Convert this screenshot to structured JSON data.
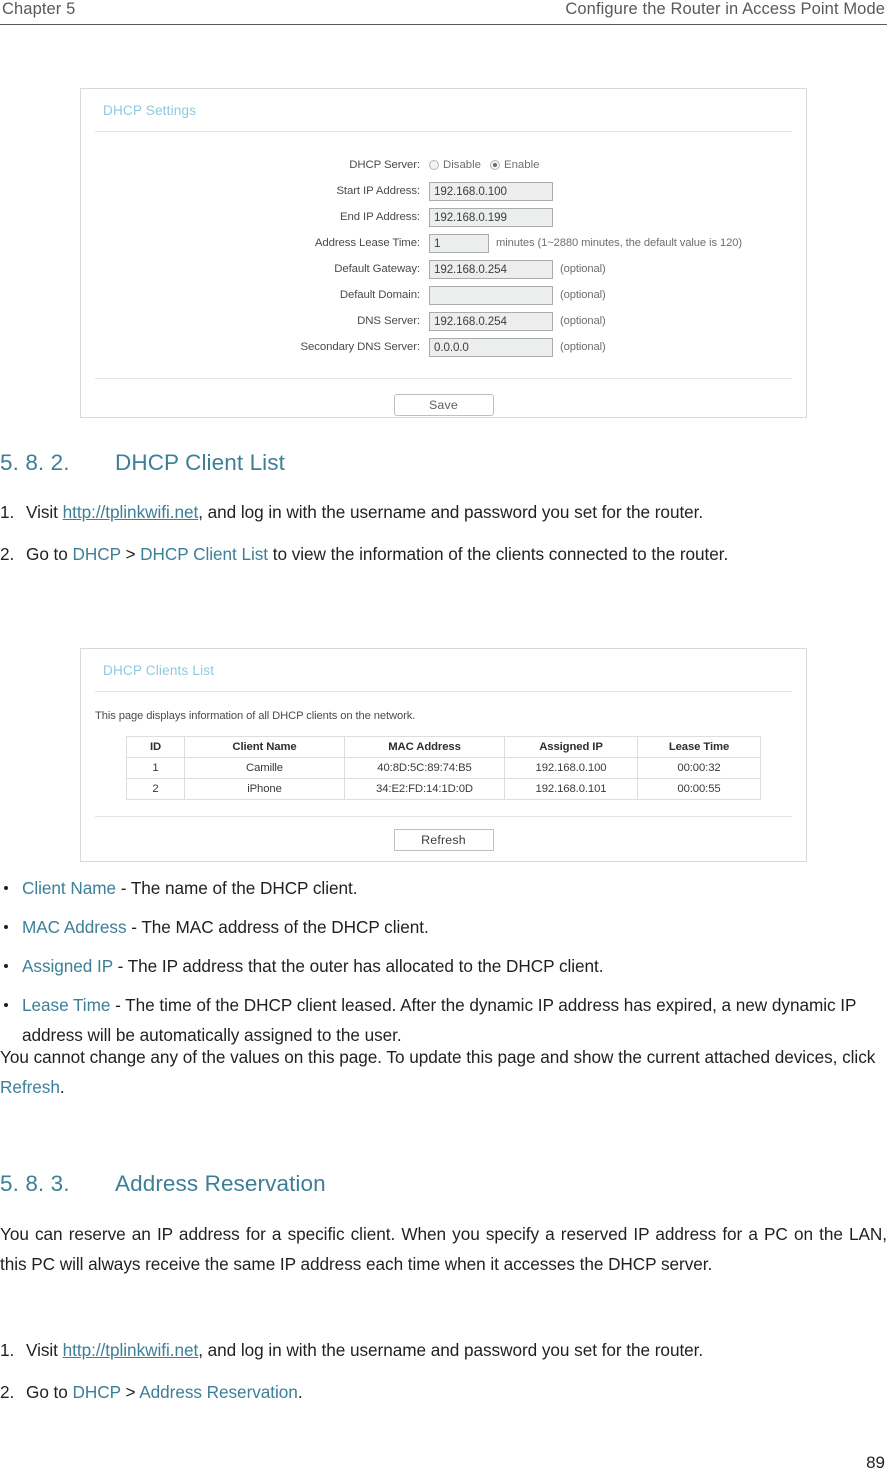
{
  "header": {
    "chapter": "Chapter 5",
    "title": "Configure the Router in Access Point Mode"
  },
  "dhcp_settings_panel": {
    "title": "DHCP Settings",
    "rows": {
      "dhcp_server_label": "DHCP Server:",
      "dhcp_server_disable": "Disable",
      "dhcp_server_enable": "Enable",
      "dhcp_server_selected": "Enable",
      "start_ip_label": "Start IP Address:",
      "start_ip_value": "192.168.0.100",
      "end_ip_label": "End IP Address:",
      "end_ip_value": "192.168.0.199",
      "lease_time_label": "Address Lease Time:",
      "lease_time_value": "1",
      "lease_time_hint": "minutes (1~2880 minutes, the default value is 120)",
      "gateway_label": "Default Gateway:",
      "gateway_value": "192.168.0.254",
      "gateway_hint": "(optional)",
      "domain_label": "Default Domain:",
      "domain_value": "",
      "domain_hint": "(optional)",
      "dns_label": "DNS Server:",
      "dns_value": "192.168.0.254",
      "dns_hint": "(optional)",
      "secondary_dns_label": "Secondary DNS Server:",
      "secondary_dns_value": "0.0.0.0",
      "secondary_dns_hint": "(optional)"
    },
    "save_label": "Save"
  },
  "section_582": {
    "number": "5. 8. 2.",
    "title": "DHCP Client List",
    "steps": [
      {
        "marker": "1.",
        "pre": "Visit ",
        "link": "http://tplinkwifi.net",
        "post": ", and log in with the username and password you set for the router."
      },
      {
        "marker": "2.",
        "pre": "Go to ",
        "nav1": "DHCP",
        "sep": " > ",
        "nav2": "DHCP Client List",
        "post": " to view the information of the clients connected to the router."
      }
    ]
  },
  "clients_panel": {
    "title": "DHCP Clients List",
    "note": "This page displays information of all DHCP clients on the network.",
    "columns": [
      "ID",
      "Client Name",
      "MAC Address",
      "Assigned IP",
      "Lease Time"
    ],
    "rows": [
      [
        "1",
        "Camille",
        "40:8D:5C:89:74:B5",
        "192.168.0.100",
        "00:00:32"
      ],
      [
        "2",
        "iPhone",
        "34:E2:FD:14:1D:0D",
        "192.168.0.101",
        "00:00:55"
      ]
    ],
    "refresh_label": "Refresh"
  },
  "field_bullets": [
    {
      "term": "Client Name",
      "desc": " - The name of the DHCP client."
    },
    {
      "term": "MAC Address",
      "desc": " - The MAC address of the DHCP client."
    },
    {
      "term": "Assigned IP",
      "desc": " - The IP address that the outer has allocated to the DHCP client."
    },
    {
      "term": "Lease Time",
      "desc": " - The time of the DHCP client leased. After the dynamic IP address has expired, a new dynamic IP address will be automatically assigned to the user."
    }
  ],
  "refresh_note": {
    "pre": "You cannot change any of the values on this page. To update this page and show the current attached devices, click ",
    "link": "Refresh",
    "post": "."
  },
  "section_583": {
    "number": "5. 8. 3.",
    "title": "Address Reservation",
    "intro": "You can reserve an IP address for a specific client. When you specify a reserved IP address for a PC on the LAN, this PC will always receive the same IP address each time when it accesses the DHCP server.",
    "steps": [
      {
        "marker": "1.",
        "pre": "Visit ",
        "link": "http://tplinkwifi.net",
        "post": ", and log in with the username and password you set for the router."
      },
      {
        "marker": "2.",
        "pre": "Go to ",
        "nav1": "DHCP",
        "sep": " > ",
        "nav2": "Address Reservation",
        "post": "."
      }
    ]
  },
  "page_number": "89",
  "colors": {
    "accent": "#3c7f97",
    "panel_title": "#8fc9dd",
    "header_text": "#58595b"
  }
}
